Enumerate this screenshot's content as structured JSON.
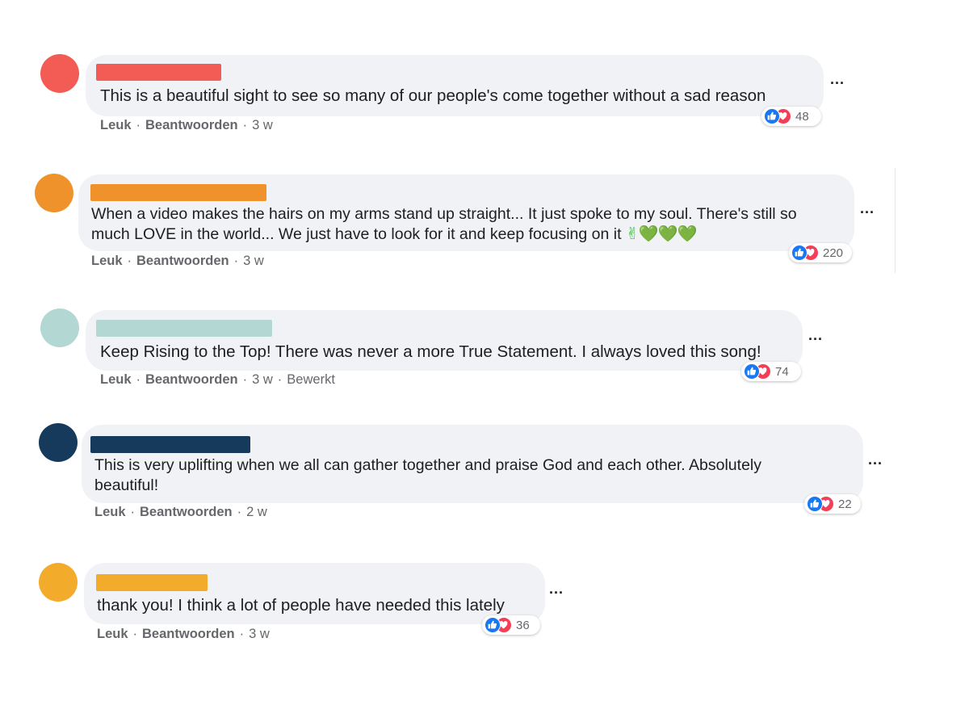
{
  "colors": {
    "bubble_bg": "#f0f2f5",
    "like_blue": "#1877f2",
    "love_red": "#f33e58",
    "meta_grey": "#65676b"
  },
  "action_labels": {
    "like": "Leuk",
    "reply": "Beantwoorden"
  },
  "comments": [
    {
      "avatar_color": "#f25c54",
      "name_bar_color": "#f25c54",
      "lines": [
        "This is a beautiful sight to see so many of our people's come together without a sad reason"
      ],
      "time": "3 w",
      "edited": "",
      "reactions": "48",
      "reaction_icons": [
        "like-icon",
        "love-icon"
      ]
    },
    {
      "avatar_color": "#f0922b",
      "name_bar_color": "#f0922b",
      "lines": [
        "When a video makes the hairs on my arms stand up straight... It just spoke to my soul. There's still so",
        "much LOVE in the world... We just have to look for it and keep focusing on it"
      ],
      "emoji": "✌💚💚💚",
      "time": "3 w",
      "edited": "",
      "reactions": "220",
      "reaction_icons": [
        "like-icon",
        "love-icon"
      ]
    },
    {
      "avatar_color": "#b3d8d4",
      "name_bar_color": "#b3d8d4",
      "lines": [
        "Keep Rising to the Top! There was never a more True Statement. I always loved this song!"
      ],
      "time": "3 w",
      "edited": "Bewerkt",
      "reactions": "74",
      "reaction_icons": [
        "like-icon",
        "love-icon"
      ]
    },
    {
      "avatar_color": "#153a5b",
      "name_bar_color": "#153a5b",
      "lines": [
        "This is very uplifting when we all can gather together and praise God and each other. Absolutely",
        "beautiful!"
      ],
      "time": "2 w",
      "edited": "",
      "reactions": "22",
      "reaction_icons": [
        "like-icon",
        "love-icon"
      ]
    },
    {
      "avatar_color": "#f2ab2b",
      "name_bar_color": "#f2ab2b",
      "lines": [
        "thank you! I think a lot of people have needed this lately"
      ],
      "time": "3 w",
      "edited": "",
      "reactions": "36",
      "reaction_icons": [
        "like-icon",
        "love-icon"
      ]
    }
  ]
}
